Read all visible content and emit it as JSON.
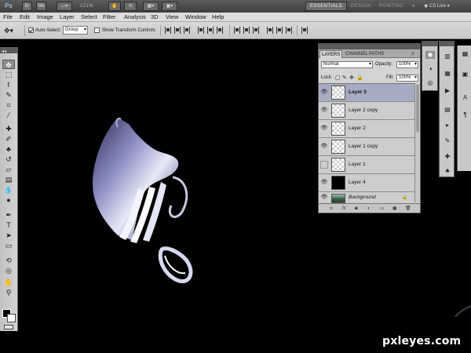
{
  "app": {
    "logo": "Ps",
    "zoom": "121%",
    "workspaces": [
      "ESSENTIALS",
      "DESIGN",
      "PAINTING",
      "»"
    ],
    "active_workspace": "ESSENTIALS",
    "cs_live": "CS Live"
  },
  "menu": [
    "File",
    "Edit",
    "Image",
    "Layer",
    "Select",
    "Filter",
    "Analysis",
    "3D",
    "View",
    "Window",
    "Help"
  ],
  "options": {
    "auto_select_label": "Auto-Select:",
    "auto_select_checked": true,
    "auto_select_value": "Group",
    "show_transform_label": "Show Transform Controls",
    "show_transform_checked": false
  },
  "tools": [
    {
      "name": "move-tool",
      "glyph": "✥"
    },
    {
      "name": "marquee-tool",
      "glyph": "⬚"
    },
    {
      "name": "lasso-tool",
      "glyph": "ℓ"
    },
    {
      "name": "quick-select-tool",
      "glyph": "✎"
    },
    {
      "name": "crop-tool",
      "glyph": "⌗"
    },
    {
      "name": "eyedropper-tool",
      "glyph": "⁄"
    },
    {
      "name": "healing-brush-tool",
      "glyph": "✚"
    },
    {
      "name": "brush-tool",
      "glyph": "✐"
    },
    {
      "name": "clone-stamp-tool",
      "glyph": "♣"
    },
    {
      "name": "history-brush-tool",
      "glyph": "↺"
    },
    {
      "name": "eraser-tool",
      "glyph": "▱"
    },
    {
      "name": "gradient-tool",
      "glyph": "▤"
    },
    {
      "name": "blur-tool",
      "glyph": "💧"
    },
    {
      "name": "dodge-tool",
      "glyph": "●"
    },
    {
      "name": "pen-tool",
      "glyph": "✒"
    },
    {
      "name": "type-tool",
      "glyph": "T"
    },
    {
      "name": "path-select-tool",
      "glyph": "➤"
    },
    {
      "name": "shape-tool",
      "glyph": "▭"
    },
    {
      "name": "3d-rotate-tool",
      "glyph": "⟲"
    },
    {
      "name": "3d-camera-tool",
      "glyph": "◎"
    },
    {
      "name": "hand-tool",
      "glyph": "✋"
    },
    {
      "name": "zoom-tool",
      "glyph": "⚲"
    }
  ],
  "layers_panel": {
    "tabs": [
      "LAYERS",
      "CHANNEL",
      "PATHS"
    ],
    "active_tab": "LAYERS",
    "blend_mode": "Normal",
    "opacity_label": "Opacity:",
    "opacity": "100%",
    "lock_label": "Lock:",
    "fill_label": "Fill:",
    "fill": "100%",
    "layers": [
      {
        "name": "Layer 3",
        "visible": true,
        "selected": true,
        "thumb": "transparent"
      },
      {
        "name": "Layer 2 copy",
        "visible": true,
        "selected": false,
        "thumb": "transparent"
      },
      {
        "name": "Layer 2",
        "visible": true,
        "selected": false,
        "thumb": "transparent"
      },
      {
        "name": "Layer 1 copy",
        "visible": true,
        "selected": false,
        "thumb": "transparent"
      },
      {
        "name": "Layer 1",
        "visible": false,
        "selected": false,
        "thumb": "transparent"
      },
      {
        "name": "Layer 4",
        "visible": true,
        "selected": false,
        "thumb": "black"
      },
      {
        "name": "Background",
        "visible": true,
        "selected": false,
        "thumb": "photo",
        "locked": true
      }
    ],
    "footer_icons": [
      "link-icon",
      "fx-icon",
      "mask-icon",
      "adjustment-icon",
      "group-icon",
      "new-layer-icon",
      "trash-icon"
    ]
  },
  "watermark": "pxleyes.com"
}
